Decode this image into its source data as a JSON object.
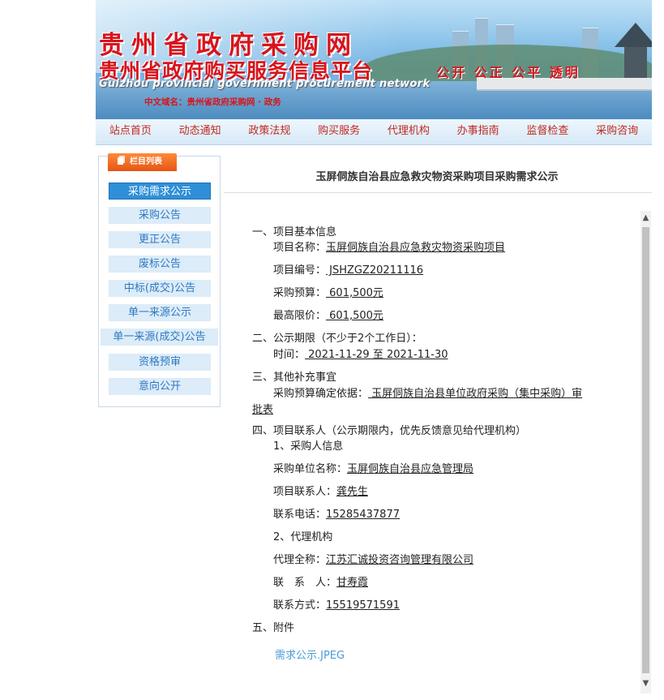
{
  "banner": {
    "title_cn": "贵州省政府采购网",
    "title_cn2": "贵州省政府购买服务信息平台",
    "title_en": "Guizhou provincial government procurement network",
    "domain_line": "中文域名：贵州省政府采购网 · 政务",
    "slogan": "公开 公正 公平 透明"
  },
  "nav": [
    "站点首页",
    "动态通知",
    "政策法规",
    "购买服务",
    "代理机构",
    "办事指南",
    "监督检查",
    "采购咨询"
  ],
  "sidebar": {
    "caption": "栏目列表",
    "items": [
      "采购需求公示",
      "采购公告",
      "更正公告",
      "废标公告",
      "中标(成交)公告",
      "单一来源公示",
      "单一来源(成交)公告",
      "资格预审",
      "意向公开"
    ],
    "active_index": 0
  },
  "content": {
    "title": "玉屏侗族自治县应急救灾物资采购项目采购需求公示",
    "s1": "一、项目基本信息",
    "name_label": "项目名称：",
    "name_value": "玉屏侗族自治县应急救灾物资采购项目",
    "code_label": "项目编号：",
    "code_value": " JSHZGZ20211116",
    "budget_label": "采购预算：",
    "budget_value": " 601,500元",
    "limit_label": "最高限价：",
    "limit_value": " 601,500元",
    "s2": "二、公示期限（不少于2个工作日）：",
    "time_label": "时间：",
    "time_value": " 2021-11-29 至 2021-11-30",
    "s3": "三、其他补充事宜",
    "basis_label": "采购预算确定依据：",
    "basis_value_1": " 玉屏侗族自治县单位政府采购（集中采购）审",
    "basis_value_2": "批表",
    "s4": "四、项目联系人（公示期限内，优先反馈意见给代理机构）",
    "buyer_head": "1、采购人信息",
    "buyer_unit_label": "采购单位名称：",
    "buyer_unit_value": "玉屏侗族自治县应急管理局",
    "buyer_contact_label": "项目联系人：",
    "buyer_contact_value": "龚先生",
    "buyer_phone_label": "联系电话：",
    "buyer_phone_value": "15285437877",
    "agent_head": "2、代理机构",
    "agent_name_label": "代理全称：",
    "agent_name_value": "江苏汇诚投资咨询管理有限公司",
    "agent_contact_label": "联　系　人：",
    "agent_contact_value": "甘寿霞",
    "agent_phone_label": "联系方式：",
    "agent_phone_value": "15519571591",
    "s5": "五、附件",
    "attachment": "需求公示.JPEG"
  }
}
